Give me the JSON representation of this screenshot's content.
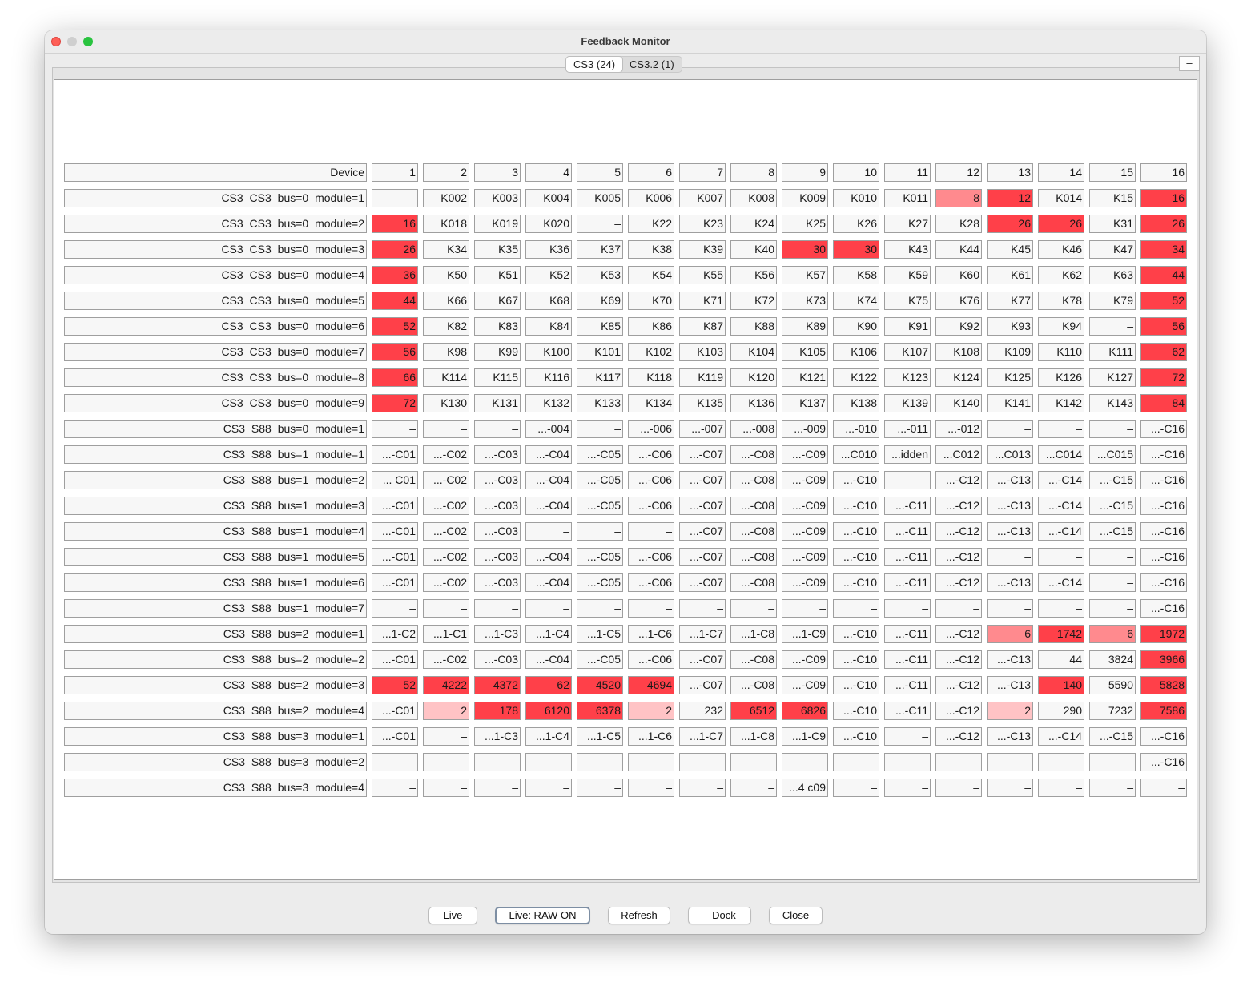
{
  "window": {
    "title": "Feedback Monitor"
  },
  "tabs": [
    {
      "label": "CS3 (24)",
      "active": true
    },
    {
      "label": "CS3.2 (1)",
      "active": false
    }
  ],
  "minimize_label": "–",
  "table": {
    "header_label": "Device",
    "columns": [
      "1",
      "2",
      "3",
      "4",
      "5",
      "6",
      "7",
      "8",
      "9",
      "10",
      "11",
      "12",
      "13",
      "14",
      "15",
      "16"
    ],
    "rows": [
      {
        "device": "CS3  CS3  bus=0  module=1",
        "cells": [
          "–",
          "K002",
          "K003",
          "K004",
          "K005",
          "K006",
          "K007",
          "K008",
          "K009",
          "K010",
          "K011",
          "8",
          "12",
          "K014",
          "K15",
          "16"
        ],
        "states": [
          "",
          "",
          "",
          "",
          "",
          "",
          "",
          "",
          "",
          "",
          "",
          "mid",
          "hot",
          "",
          "",
          "hot"
        ]
      },
      {
        "device": "CS3  CS3  bus=0  module=2",
        "cells": [
          "16",
          "K018",
          "K019",
          "K020",
          "–",
          "K22",
          "K23",
          "K24",
          "K25",
          "K26",
          "K27",
          "K28",
          "26",
          "26",
          "K31",
          "26"
        ],
        "states": [
          "hot",
          "",
          "",
          "",
          "",
          "",
          "",
          "",
          "",
          "",
          "",
          "",
          "hot",
          "hot",
          "",
          "hot"
        ]
      },
      {
        "device": "CS3  CS3  bus=0  module=3",
        "cells": [
          "26",
          "K34",
          "K35",
          "K36",
          "K37",
          "K38",
          "K39",
          "K40",
          "30",
          "30",
          "K43",
          "K44",
          "K45",
          "K46",
          "K47",
          "34"
        ],
        "states": [
          "hot",
          "",
          "",
          "",
          "",
          "",
          "",
          "",
          "hot",
          "hot",
          "",
          "",
          "",
          "",
          "",
          "hot"
        ]
      },
      {
        "device": "CS3  CS3  bus=0  module=4",
        "cells": [
          "36",
          "K50",
          "K51",
          "K52",
          "K53",
          "K54",
          "K55",
          "K56",
          "K57",
          "K58",
          "K59",
          "K60",
          "K61",
          "K62",
          "K63",
          "44"
        ],
        "states": [
          "hot",
          "",
          "",
          "",
          "",
          "",
          "",
          "",
          "",
          "",
          "",
          "",
          "",
          "",
          "",
          "hot"
        ]
      },
      {
        "device": "CS3  CS3  bus=0  module=5",
        "cells": [
          "44",
          "K66",
          "K67",
          "K68",
          "K69",
          "K70",
          "K71",
          "K72",
          "K73",
          "K74",
          "K75",
          "K76",
          "K77",
          "K78",
          "K79",
          "52"
        ],
        "states": [
          "hot",
          "",
          "",
          "",
          "",
          "",
          "",
          "",
          "",
          "",
          "",
          "",
          "",
          "",
          "",
          "hot"
        ]
      },
      {
        "device": "CS3  CS3  bus=0  module=6",
        "cells": [
          "52",
          "K82",
          "K83",
          "K84",
          "K85",
          "K86",
          "K87",
          "K88",
          "K89",
          "K90",
          "K91",
          "K92",
          "K93",
          "K94",
          "–",
          "56"
        ],
        "states": [
          "hot",
          "",
          "",
          "",
          "",
          "",
          "",
          "",
          "",
          "",
          "",
          "",
          "",
          "",
          "",
          "hot"
        ]
      },
      {
        "device": "CS3  CS3  bus=0  module=7",
        "cells": [
          "56",
          "K98",
          "K99",
          "K100",
          "K101",
          "K102",
          "K103",
          "K104",
          "K105",
          "K106",
          "K107",
          "K108",
          "K109",
          "K110",
          "K111",
          "62"
        ],
        "states": [
          "hot",
          "",
          "",
          "",
          "",
          "",
          "",
          "",
          "",
          "",
          "",
          "",
          "",
          "",
          "",
          "hot"
        ]
      },
      {
        "device": "CS3  CS3  bus=0  module=8",
        "cells": [
          "66",
          "K114",
          "K115",
          "K116",
          "K117",
          "K118",
          "K119",
          "K120",
          "K121",
          "K122",
          "K123",
          "K124",
          "K125",
          "K126",
          "K127",
          "72"
        ],
        "states": [
          "hot",
          "",
          "",
          "",
          "",
          "",
          "",
          "",
          "",
          "",
          "",
          "",
          "",
          "",
          "",
          "hot"
        ]
      },
      {
        "device": "CS3  CS3  bus=0  module=9",
        "cells": [
          "72",
          "K130",
          "K131",
          "K132",
          "K133",
          "K134",
          "K135",
          "K136",
          "K137",
          "K138",
          "K139",
          "K140",
          "K141",
          "K142",
          "K143",
          "84"
        ],
        "states": [
          "hot",
          "",
          "",
          "",
          "",
          "",
          "",
          "",
          "",
          "",
          "",
          "",
          "",
          "",
          "",
          "hot"
        ]
      },
      {
        "device": "CS3  S88  bus=0  module=1",
        "cells": [
          "–",
          "–",
          "–",
          "...-004",
          "–",
          "...-006",
          "...-007",
          "...-008",
          "...-009",
          "...-010",
          "...-011",
          "...-012",
          "–",
          "–",
          "–",
          "...-C16"
        ],
        "states": [
          "",
          "",
          "",
          "",
          "",
          "",
          "",
          "",
          "",
          "",
          "",
          "",
          "",
          "",
          "",
          ""
        ]
      },
      {
        "device": "CS3  S88  bus=1  module=1",
        "cells": [
          "...-C01",
          "...-C02",
          "...-C03",
          "...-C04",
          "...-C05",
          "...-C06",
          "...-C07",
          "...-C08",
          "...-C09",
          "...C010",
          "...idden",
          "...C012",
          "...C013",
          "...C014",
          "...C015",
          "...-C16"
        ],
        "states": [
          "",
          "",
          "",
          "",
          "",
          "",
          "",
          "",
          "",
          "",
          "",
          "",
          "",
          "",
          "",
          ""
        ]
      },
      {
        "device": "CS3  S88  bus=1  module=2",
        "cells": [
          "... C01",
          "...-C02",
          "...-C03",
          "...-C04",
          "...-C05",
          "...-C06",
          "...-C07",
          "...-C08",
          "...-C09",
          "...-C10",
          "–",
          "...-C12",
          "...-C13",
          "...-C14",
          "...-C15",
          "...-C16"
        ],
        "states": [
          "",
          "",
          "",
          "",
          "",
          "",
          "",
          "",
          "",
          "",
          "",
          "",
          "",
          "",
          "",
          ""
        ]
      },
      {
        "device": "CS3  S88  bus=1  module=3",
        "cells": [
          "...-C01",
          "...-C02",
          "...-C03",
          "...-C04",
          "...-C05",
          "...-C06",
          "...-C07",
          "...-C08",
          "...-C09",
          "...-C10",
          "...-C11",
          "...-C12",
          "...-C13",
          "...-C14",
          "...-C15",
          "...-C16"
        ],
        "states": [
          "",
          "",
          "",
          "",
          "",
          "",
          "",
          "",
          "",
          "",
          "",
          "",
          "",
          "",
          "",
          ""
        ]
      },
      {
        "device": "CS3  S88  bus=1  module=4",
        "cells": [
          "...-C01",
          "...-C02",
          "...-C03",
          "–",
          "–",
          "–",
          "...-C07",
          "...-C08",
          "...-C09",
          "...-C10",
          "...-C11",
          "...-C12",
          "...-C13",
          "...-C14",
          "...-C15",
          "...-C16"
        ],
        "states": [
          "",
          "",
          "",
          "",
          "",
          "",
          "",
          "",
          "",
          "",
          "",
          "",
          "",
          "",
          "",
          ""
        ]
      },
      {
        "device": "CS3  S88  bus=1  module=5",
        "cells": [
          "...-C01",
          "...-C02",
          "...-C03",
          "...-C04",
          "...-C05",
          "...-C06",
          "...-C07",
          "...-C08",
          "...-C09",
          "...-C10",
          "...-C11",
          "...-C12",
          "–",
          "–",
          "–",
          "...-C16"
        ],
        "states": [
          "",
          "",
          "",
          "",
          "",
          "",
          "",
          "",
          "",
          "",
          "",
          "",
          "",
          "",
          "",
          ""
        ]
      },
      {
        "device": "CS3  S88  bus=1  module=6",
        "cells": [
          "...-C01",
          "...-C02",
          "...-C03",
          "...-C04",
          "...-C05",
          "...-C06",
          "...-C07",
          "...-C08",
          "...-C09",
          "...-C10",
          "...-C11",
          "...-C12",
          "...-C13",
          "...-C14",
          "–",
          "...-C16"
        ],
        "states": [
          "",
          "",
          "",
          "",
          "",
          "",
          "",
          "",
          "",
          "",
          "",
          "",
          "",
          "",
          "",
          ""
        ]
      },
      {
        "device": "CS3  S88  bus=1  module=7",
        "cells": [
          "–",
          "–",
          "–",
          "–",
          "–",
          "–",
          "–",
          "–",
          "–",
          "–",
          "–",
          "–",
          "–",
          "–",
          "–",
          "...-C16"
        ],
        "states": [
          "",
          "",
          "",
          "",
          "",
          "",
          "",
          "",
          "",
          "",
          "",
          "",
          "",
          "",
          "",
          ""
        ]
      },
      {
        "device": "CS3  S88  bus=2  module=1",
        "cells": [
          "...1-C2",
          "...1-C1",
          "...1-C3",
          "...1-C4",
          "...1-C5",
          "...1-C6",
          "...1-C7",
          "...1-C8",
          "...1-C9",
          "...-C10",
          "...-C11",
          "...-C12",
          "6",
          "1742",
          "6",
          "1972"
        ],
        "states": [
          "",
          "",
          "",
          "",
          "",
          "",
          "",
          "",
          "",
          "",
          "",
          "",
          "mid",
          "hot",
          "mid",
          "hot"
        ]
      },
      {
        "device": "CS3  S88  bus=2  module=2",
        "cells": [
          "...-C01",
          "...-C02",
          "...-C03",
          "...-C04",
          "...-C05",
          "...-C06",
          "...-C07",
          "...-C08",
          "...-C09",
          "...-C10",
          "...-C11",
          "...-C12",
          "...-C13",
          "44",
          "3824",
          "3966"
        ],
        "states": [
          "",
          "",
          "",
          "",
          "",
          "",
          "",
          "",
          "",
          "",
          "",
          "",
          "",
          "",
          "",
          "hot"
        ]
      },
      {
        "device": "CS3  S88  bus=2  module=3",
        "cells": [
          "52",
          "4222",
          "4372",
          "62",
          "4520",
          "4694",
          "...-C07",
          "...-C08",
          "...-C09",
          "...-C10",
          "...-C11",
          "...-C12",
          "...-C13",
          "140",
          "5590",
          "5828"
        ],
        "states": [
          "hot",
          "hot",
          "hot",
          "hot",
          "hot",
          "hot",
          "",
          "",
          "",
          "",
          "",
          "",
          "",
          "hot",
          "",
          "hot"
        ]
      },
      {
        "device": "CS3  S88  bus=2  module=4",
        "cells": [
          "...-C01",
          "2",
          "178",
          "6120",
          "6378",
          "2",
          "232",
          "6512",
          "6826",
          "...-C10",
          "...-C11",
          "...-C12",
          "2",
          "290",
          "7232",
          "7586"
        ],
        "states": [
          "",
          "light",
          "hot",
          "hot",
          "hot",
          "light",
          "",
          "hot",
          "hot",
          "",
          "",
          "",
          "light",
          "",
          "",
          "hot"
        ]
      },
      {
        "device": "CS3  S88  bus=3  module=1",
        "cells": [
          "...-C01",
          "–",
          "...1-C3",
          "...1-C4",
          "...1-C5",
          "...1-C6",
          "...1-C7",
          "...1-C8",
          "...1-C9",
          "...-C10",
          "–",
          "...-C12",
          "...-C13",
          "...-C14",
          "...-C15",
          "...-C16"
        ],
        "states": [
          "",
          "",
          "",
          "",
          "",
          "",
          "",
          "",
          "",
          "",
          "",
          "",
          "",
          "",
          "",
          ""
        ]
      },
      {
        "device": "CS3  S88  bus=3  module=2",
        "cells": [
          "–",
          "–",
          "–",
          "–",
          "–",
          "–",
          "–",
          "–",
          "–",
          "–",
          "–",
          "–",
          "–",
          "–",
          "–",
          "...-C16"
        ],
        "states": [
          "",
          "",
          "",
          "",
          "",
          "",
          "",
          "",
          "",
          "",
          "",
          "",
          "",
          "",
          "",
          ""
        ]
      },
      {
        "device": "CS3  S88  bus=3  module=4",
        "cells": [
          "–",
          "–",
          "–",
          "–",
          "–",
          "–",
          "–",
          "–",
          "...4 c09",
          "–",
          "–",
          "–",
          "–",
          "–",
          "–",
          "–"
        ],
        "states": [
          "",
          "",
          "",
          "",
          "",
          "",
          "",
          "",
          "",
          "",
          "",
          "",
          "",
          "",
          "",
          ""
        ]
      }
    ]
  },
  "colors": {
    "hot": "#ff4049",
    "mid": "#ff8a8e",
    "light": "#ffc3c5"
  },
  "footer": {
    "buttons": [
      {
        "label": "Live",
        "name": "live-button"
      },
      {
        "label": "Live: RAW ON",
        "name": "live-raw-button",
        "focused": true
      },
      {
        "label": "Refresh",
        "name": "refresh-button"
      },
      {
        "label": "– Dock",
        "name": "dock-button"
      },
      {
        "label": "Close",
        "name": "close-button"
      }
    ]
  }
}
